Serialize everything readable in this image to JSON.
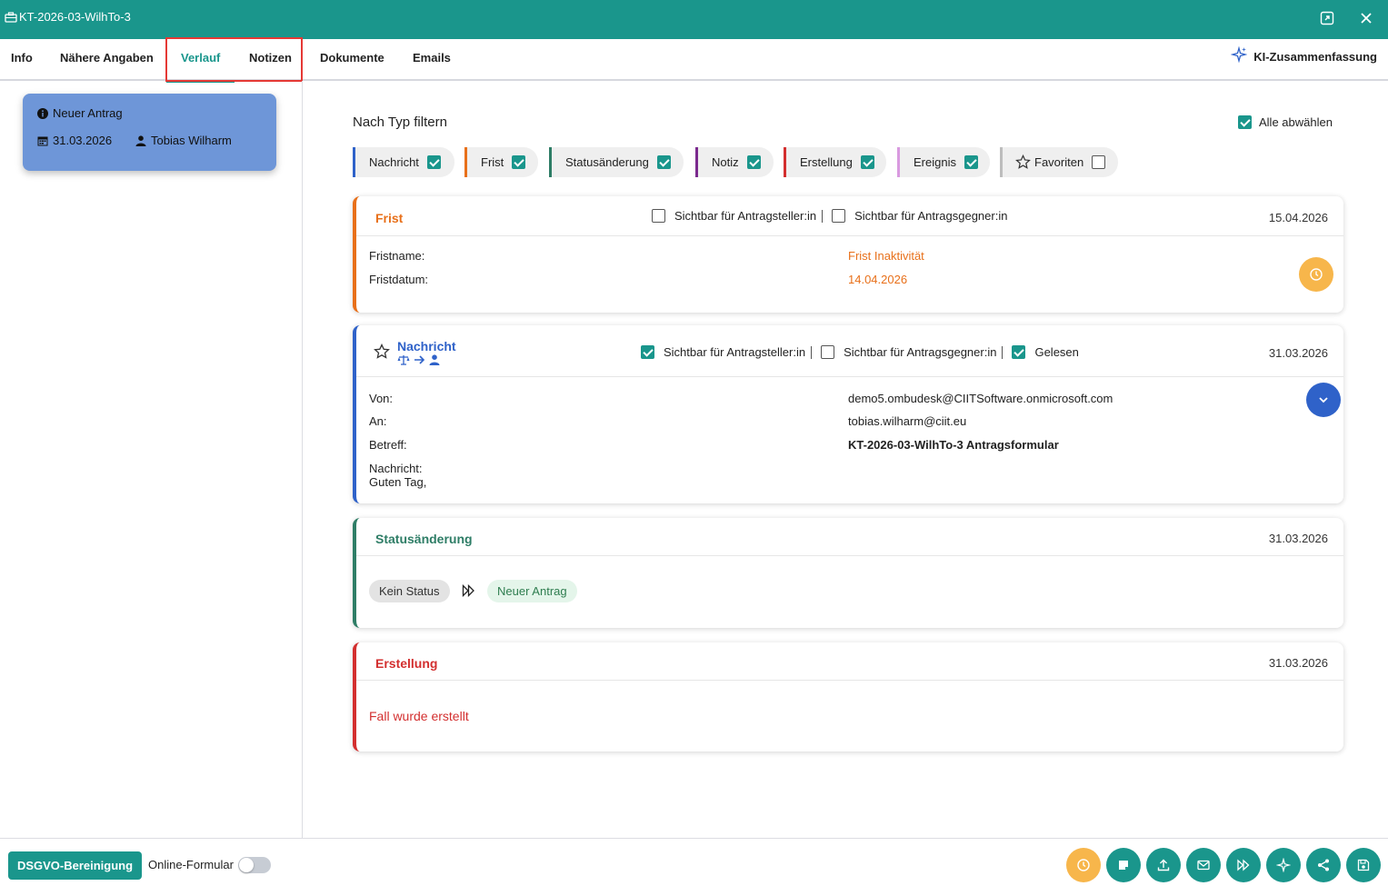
{
  "colors": {
    "accent": "#1a968c",
    "nachricht": "#2f62c9",
    "frist": "#e8701a",
    "status": "#2e7d66",
    "notiz": "#7b2a8e",
    "erstellung": "#d32f2f",
    "ereignis": "#d99ae0",
    "favoriten": "#bdbdbd"
  },
  "window": {
    "title": "KT-2026-03-WilhTo-3"
  },
  "tabs": [
    "Info",
    "Nähere Angaben",
    "Verlauf",
    "Notizen",
    "Dokumente",
    "Emails"
  ],
  "active_tab": "Verlauf",
  "ki_summary_label": "KI-Zusammenfassung",
  "left_card": {
    "status": "Neuer Antrag",
    "date": "31.03.2026",
    "user": "Tobias Wilharm"
  },
  "filter": {
    "title": "Nach Typ filtern",
    "deselect_all": "Alle abwählen",
    "chips": [
      {
        "label": "Nachricht",
        "checked": true
      },
      {
        "label": "Frist",
        "checked": true
      },
      {
        "label": "Statusänderung",
        "checked": true
      },
      {
        "label": "Notiz",
        "checked": true
      },
      {
        "label": "Erstellung",
        "checked": true
      },
      {
        "label": "Ereignis",
        "checked": true
      },
      {
        "label": "Favoriten",
        "checked": false
      }
    ]
  },
  "entries": {
    "frist": {
      "title": "Frist",
      "visible_applicant": "Sichtbar für Antragsteller:in",
      "visible_opponent": "Sichtbar für Antragsgegner:in",
      "date": "15.04.2026",
      "name_label": "Fristname:",
      "name_value": "Frist Inaktivität",
      "date_label": "Fristdatum:",
      "date_value": "14.04.2026"
    },
    "nachricht": {
      "title": "Nachricht",
      "visible_applicant": "Sichtbar für Antragsteller:in",
      "visible_opponent": "Sichtbar für Antragsgegner:in",
      "read": "Gelesen",
      "date": "31.03.2026",
      "from_label": "Von:",
      "from_value": "demo5.ombudesk@CIITSoftware.onmicrosoft.com",
      "to_label": "An:",
      "to_value": "tobias.wilharm@ciit.eu",
      "subject_label": "Betreff:",
      "subject_value": "KT-2026-03-WilhTo-3 Antragsformular",
      "message_label": "Nachricht:",
      "message_value": "Guten Tag,"
    },
    "status": {
      "title": "Statusänderung",
      "date": "31.03.2026",
      "from": "Kein Status",
      "to": "Neuer Antrag"
    },
    "erstellung": {
      "title": "Erstellung",
      "date": "31.03.2026",
      "text": "Fall wurde erstellt"
    }
  },
  "footer": {
    "dsgvo_button": "DSGVO-Bereinigung",
    "online_form": "Online-Formular",
    "actions": [
      "clock-icon",
      "note-icon",
      "upload-icon",
      "mail-icon",
      "fast-forward-icon",
      "sparkle-icon",
      "share-icon",
      "save-icon"
    ]
  }
}
